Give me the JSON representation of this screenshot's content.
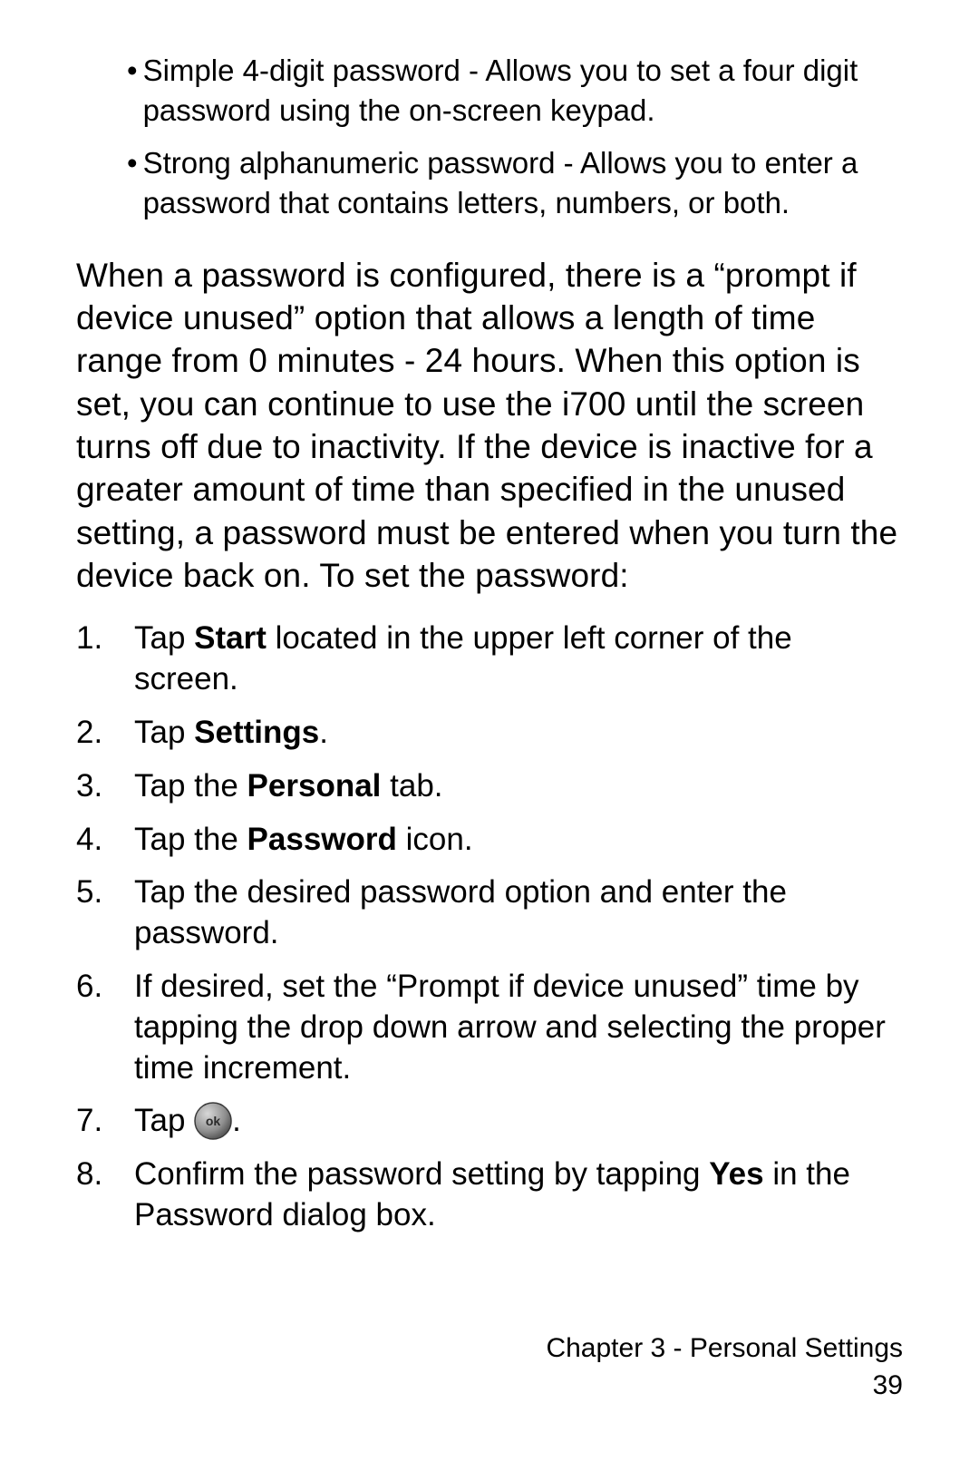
{
  "bullets": [
    "Simple 4-digit password - Allows you to set a four digit password using the on-screen keypad.",
    "Strong alphanumeric password - Allows you to enter a password that contains letters, numbers, or both."
  ],
  "paragraph": "When a password is configured, there is a “prompt if device unused” option that allows a length of time range from 0 minutes - 24 hours. When this option is set, you can continue to use the i700 until the screen turns off due to inactivity. If the device is inactive for a greater amount of time than specified in the unused setting, a password must be entered when you turn the device back on. To set the password:",
  "steps": {
    "s1": {
      "num": "1.",
      "pre": "Tap ",
      "bold": "Start",
      "post": " located in the upper left corner of the screen."
    },
    "s2": {
      "num": "2.",
      "pre": "Tap ",
      "bold": "Settings",
      "post": "."
    },
    "s3": {
      "num": "3.",
      "pre": "Tap the ",
      "bold": "Personal",
      "post": " tab."
    },
    "s4": {
      "num": "4.",
      "pre": "Tap the ",
      "bold": "Password",
      "post": " icon."
    },
    "s5": {
      "num": "5.",
      "text": "Tap the desired password option and enter the password."
    },
    "s6": {
      "num": "6.",
      "text": "If desired, set the “Prompt if device unused” time by tapping the drop down arrow and selecting the proper time increment."
    },
    "s7": {
      "num": "7.",
      "pre": "Tap  ",
      "post": "."
    },
    "s8": {
      "num": "8.",
      "pre": "Confirm the password setting by tapping ",
      "bold": "Yes",
      "post": " in the Password dialog box."
    }
  },
  "ok_label": "ok",
  "footer": {
    "chapter": "Chapter 3 - Personal Settings",
    "page": "39"
  }
}
